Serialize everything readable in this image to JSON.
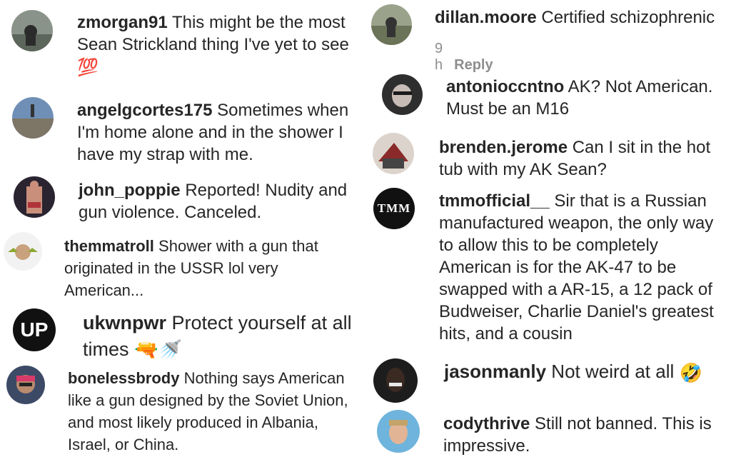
{
  "left": [
    {
      "user": "zmorgan91",
      "text": "This might be the most Sean Strickland thing I've yet to see",
      "emoji": "💯"
    },
    {
      "user": "angelgcortes175",
      "text": "Sometimes when I'm home alone and in the shower I have my strap with me."
    },
    {
      "user": "john_poppie",
      "text": "Reported! Nudity and gun violence. Canceled."
    },
    {
      "user": "themmatroll",
      "text": "Shower with a gun that originated in the USSR lol very American..."
    },
    {
      "user": "ukwnpwr",
      "text": "Protect yourself at all times",
      "emoji": "🔫🚿",
      "avatar_text": "UP"
    },
    {
      "user": "bonelessbrody",
      "text": "Nothing says American like a gun designed by the Soviet Union, and most likely produced in Albania, Israel, or China."
    }
  ],
  "right": [
    {
      "user": "dillan.moore",
      "text": "Certified schizophrenic",
      "time": "9 h",
      "reply": "Reply"
    },
    {
      "user": "antonioccntno",
      "text": "AK? Not American. Must be an M16"
    },
    {
      "user": "brenden.jerome",
      "text": "Can I sit in the hot tub with my AK Sean?"
    },
    {
      "user": "tmmofficial__",
      "text": "Sir that is a Russian manufactured weapon, the only way to allow this to be completely American is for the AK-47 to be swapped with a AR-15, a 12 pack of Budweiser, Charlie Daniel's greatest hits, and a cousin",
      "avatar_text": "TMM"
    },
    {
      "user": "jasonmanly",
      "text": "Not weird at all",
      "emoji": "🤣"
    },
    {
      "user": "codythrive",
      "text": "Still not banned. This is impressive."
    }
  ]
}
